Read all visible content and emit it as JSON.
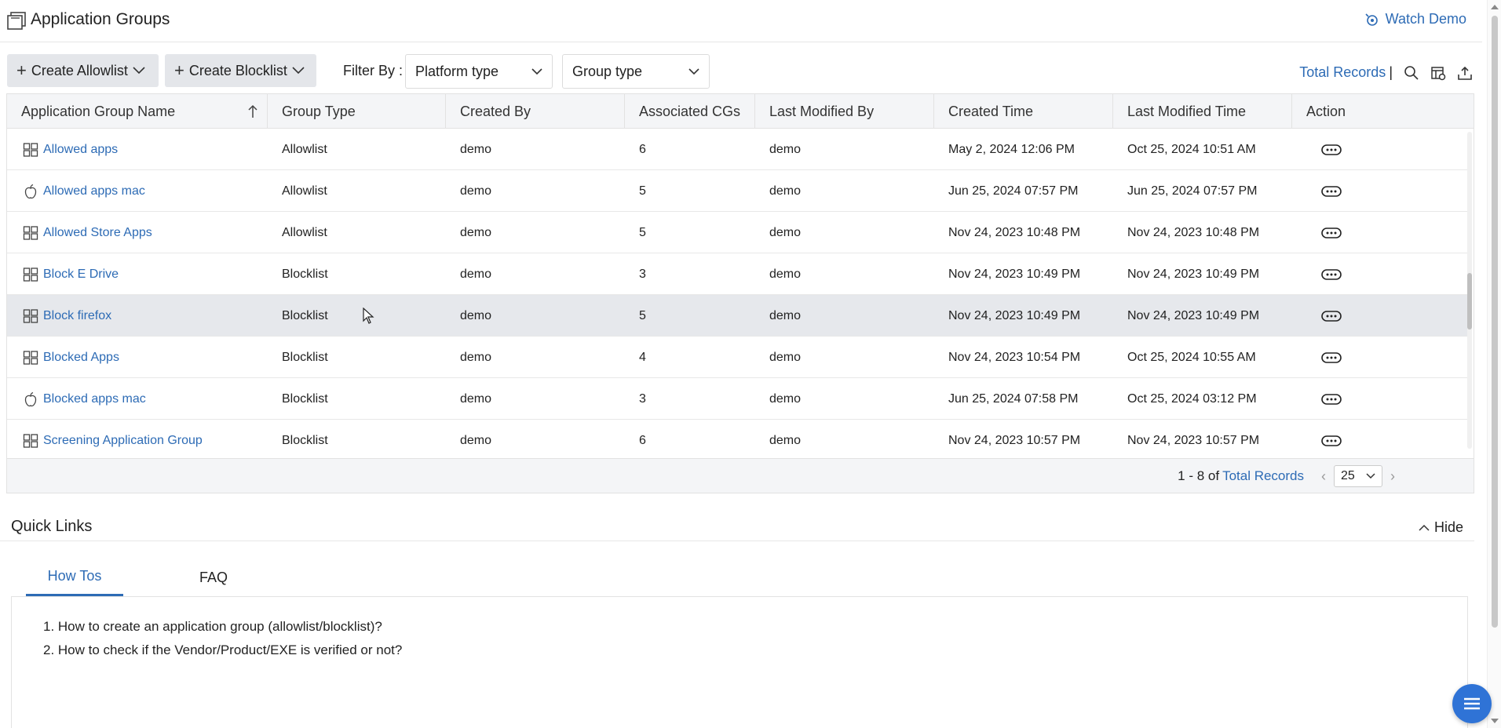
{
  "header": {
    "title": "Application Groups",
    "watch_demo": "Watch Demo"
  },
  "toolbar": {
    "create_allowlist": "Create Allowlist",
    "create_blocklist": "Create Blocklist",
    "filter_label": "Filter By :",
    "platform_select": "Platform type",
    "group_select": "Group type",
    "total_records": "Total Records",
    "separator": "|"
  },
  "table": {
    "columns": [
      "Application Group Name",
      "Group Type",
      "Created By",
      "Associated CGs",
      "Last Modified By",
      "Created Time",
      "Last Modified Time",
      "Action"
    ],
    "rows": [
      {
        "name": "Allowed apps",
        "platform": "windows",
        "group_type": "Allowlist",
        "created_by": "demo",
        "cgs": "6",
        "modified_by": "demo",
        "created": "May 2, 2024 12:06 PM",
        "modified": "Oct 25, 2024 10:51 AM"
      },
      {
        "name": "Allowed apps mac",
        "platform": "mac",
        "group_type": "Allowlist",
        "created_by": "demo",
        "cgs": "5",
        "modified_by": "demo",
        "created": "Jun 25, 2024 07:57 PM",
        "modified": "Jun 25, 2024 07:57 PM"
      },
      {
        "name": "Allowed Store Apps",
        "platform": "windows",
        "group_type": "Allowlist",
        "created_by": "demo",
        "cgs": "5",
        "modified_by": "demo",
        "created": "Nov 24, 2023 10:48 PM",
        "modified": "Nov 24, 2023 10:48 PM"
      },
      {
        "name": "Block E Drive",
        "platform": "windows",
        "group_type": "Blocklist",
        "created_by": "demo",
        "cgs": "3",
        "modified_by": "demo",
        "created": "Nov 24, 2023 10:49 PM",
        "modified": "Nov 24, 2023 10:49 PM"
      },
      {
        "name": "Block firefox",
        "platform": "windows",
        "group_type": "Blocklist",
        "created_by": "demo",
        "cgs": "5",
        "modified_by": "demo",
        "created": "Nov 24, 2023 10:49 PM",
        "modified": "Nov 24, 2023 10:49 PM"
      },
      {
        "name": "Blocked Apps",
        "platform": "windows",
        "group_type": "Blocklist",
        "created_by": "demo",
        "cgs": "4",
        "modified_by": "demo",
        "created": "Nov 24, 2023 10:54 PM",
        "modified": "Oct 25, 2024 10:55 AM"
      },
      {
        "name": "Blocked apps mac",
        "platform": "mac",
        "group_type": "Blocklist",
        "created_by": "demo",
        "cgs": "3",
        "modified_by": "demo",
        "created": "Jun 25, 2024 07:58 PM",
        "modified": "Oct 25, 2024 03:12 PM"
      },
      {
        "name": "Screening Application Group",
        "platform": "windows",
        "group_type": "Blocklist",
        "created_by": "demo",
        "cgs": "6",
        "modified_by": "demo",
        "created": "Nov 24, 2023 10:57 PM",
        "modified": "Nov 24, 2023 10:57 PM"
      }
    ]
  },
  "pagination": {
    "range": "1 - 8 of",
    "total_records": "Total Records",
    "page_size": "25",
    "prev": "‹",
    "next": "›"
  },
  "quick_links": {
    "title": "Quick Links",
    "hide": "Hide",
    "tabs": [
      "How Tos",
      "FAQ"
    ],
    "items": [
      "1. How to create an application group (allowlist/blocklist)?",
      "2. How to check if the Vendor/Product/EXE is verified or not?"
    ]
  },
  "colors": {
    "accent": "#2d6bb5",
    "hover_row": "#e6e8ec",
    "fab": "#2f73d6"
  }
}
